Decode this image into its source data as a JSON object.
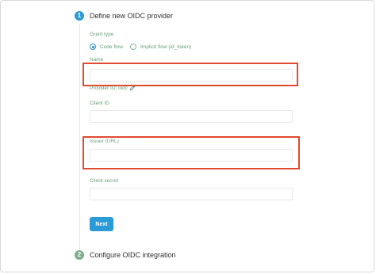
{
  "steps": [
    {
      "number": "1",
      "title": "Define new OIDC provider",
      "color": "#2a9bd6"
    },
    {
      "number": "2",
      "title": "Configure OIDC integration",
      "color": "#7fae8c"
    }
  ],
  "form": {
    "grant_type_label": "Grant type",
    "grant_options": [
      {
        "label": "Code flow",
        "selected": true
      },
      {
        "label": "Implicit flow (id_token)",
        "selected": false
      }
    ],
    "name_label": "Name",
    "name_value": "",
    "provider_id_label": "Provider ID: oidc",
    "client_id_label": "Client ID",
    "client_id_value": "",
    "issuer_label": "Issuer (URL)",
    "issuer_value": "",
    "client_secret_label": "Client secret",
    "client_secret_value": ""
  },
  "actions": {
    "next_label": "Next"
  },
  "colors": {
    "accent": "#2a9bd6",
    "highlight": "#e04a2f",
    "label": "#6aa07a"
  }
}
